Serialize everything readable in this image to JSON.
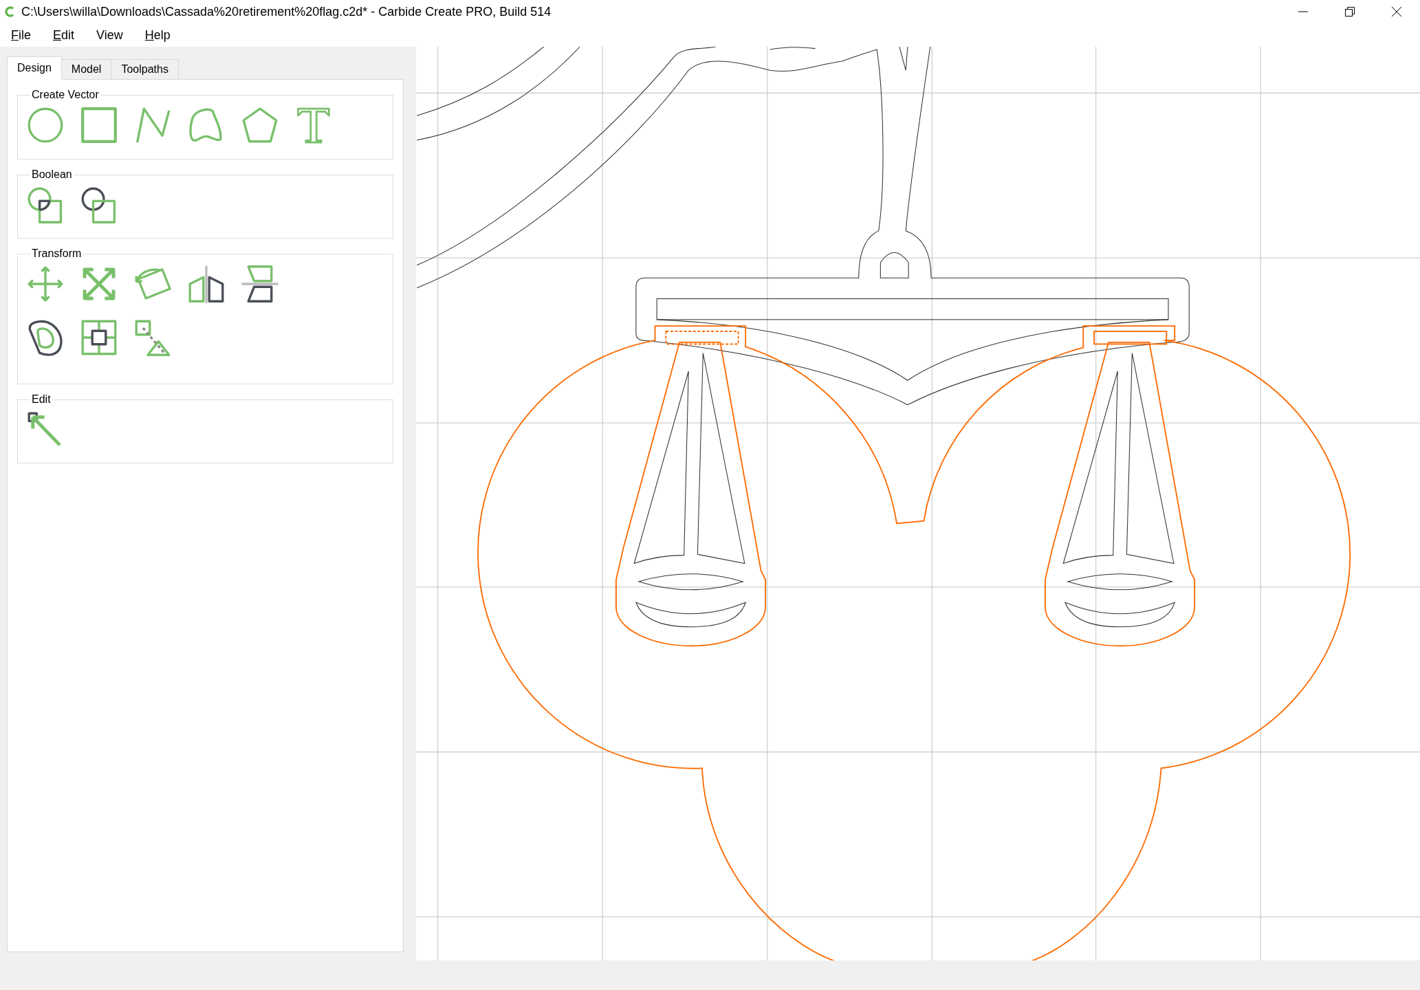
{
  "window": {
    "title": "C:\\Users\\willa\\Downloads\\Cassada%20retirement%20flag.c2d* - Carbide Create PRO, Build 514"
  },
  "menu": [
    {
      "label": "File",
      "underlined": true
    },
    {
      "label": "Edit",
      "underlined": true
    },
    {
      "label": "View",
      "underlined": false
    },
    {
      "label": "Help",
      "underlined": true
    }
  ],
  "tabs": [
    {
      "label": "Design",
      "selected": true
    },
    {
      "label": "Model",
      "selected": false
    },
    {
      "label": "Toolpaths",
      "selected": false
    }
  ],
  "groups": [
    {
      "title": "Create Vector"
    },
    {
      "title": "Boolean"
    },
    {
      "title": "Transform"
    },
    {
      "title": "Edit"
    }
  ]
}
